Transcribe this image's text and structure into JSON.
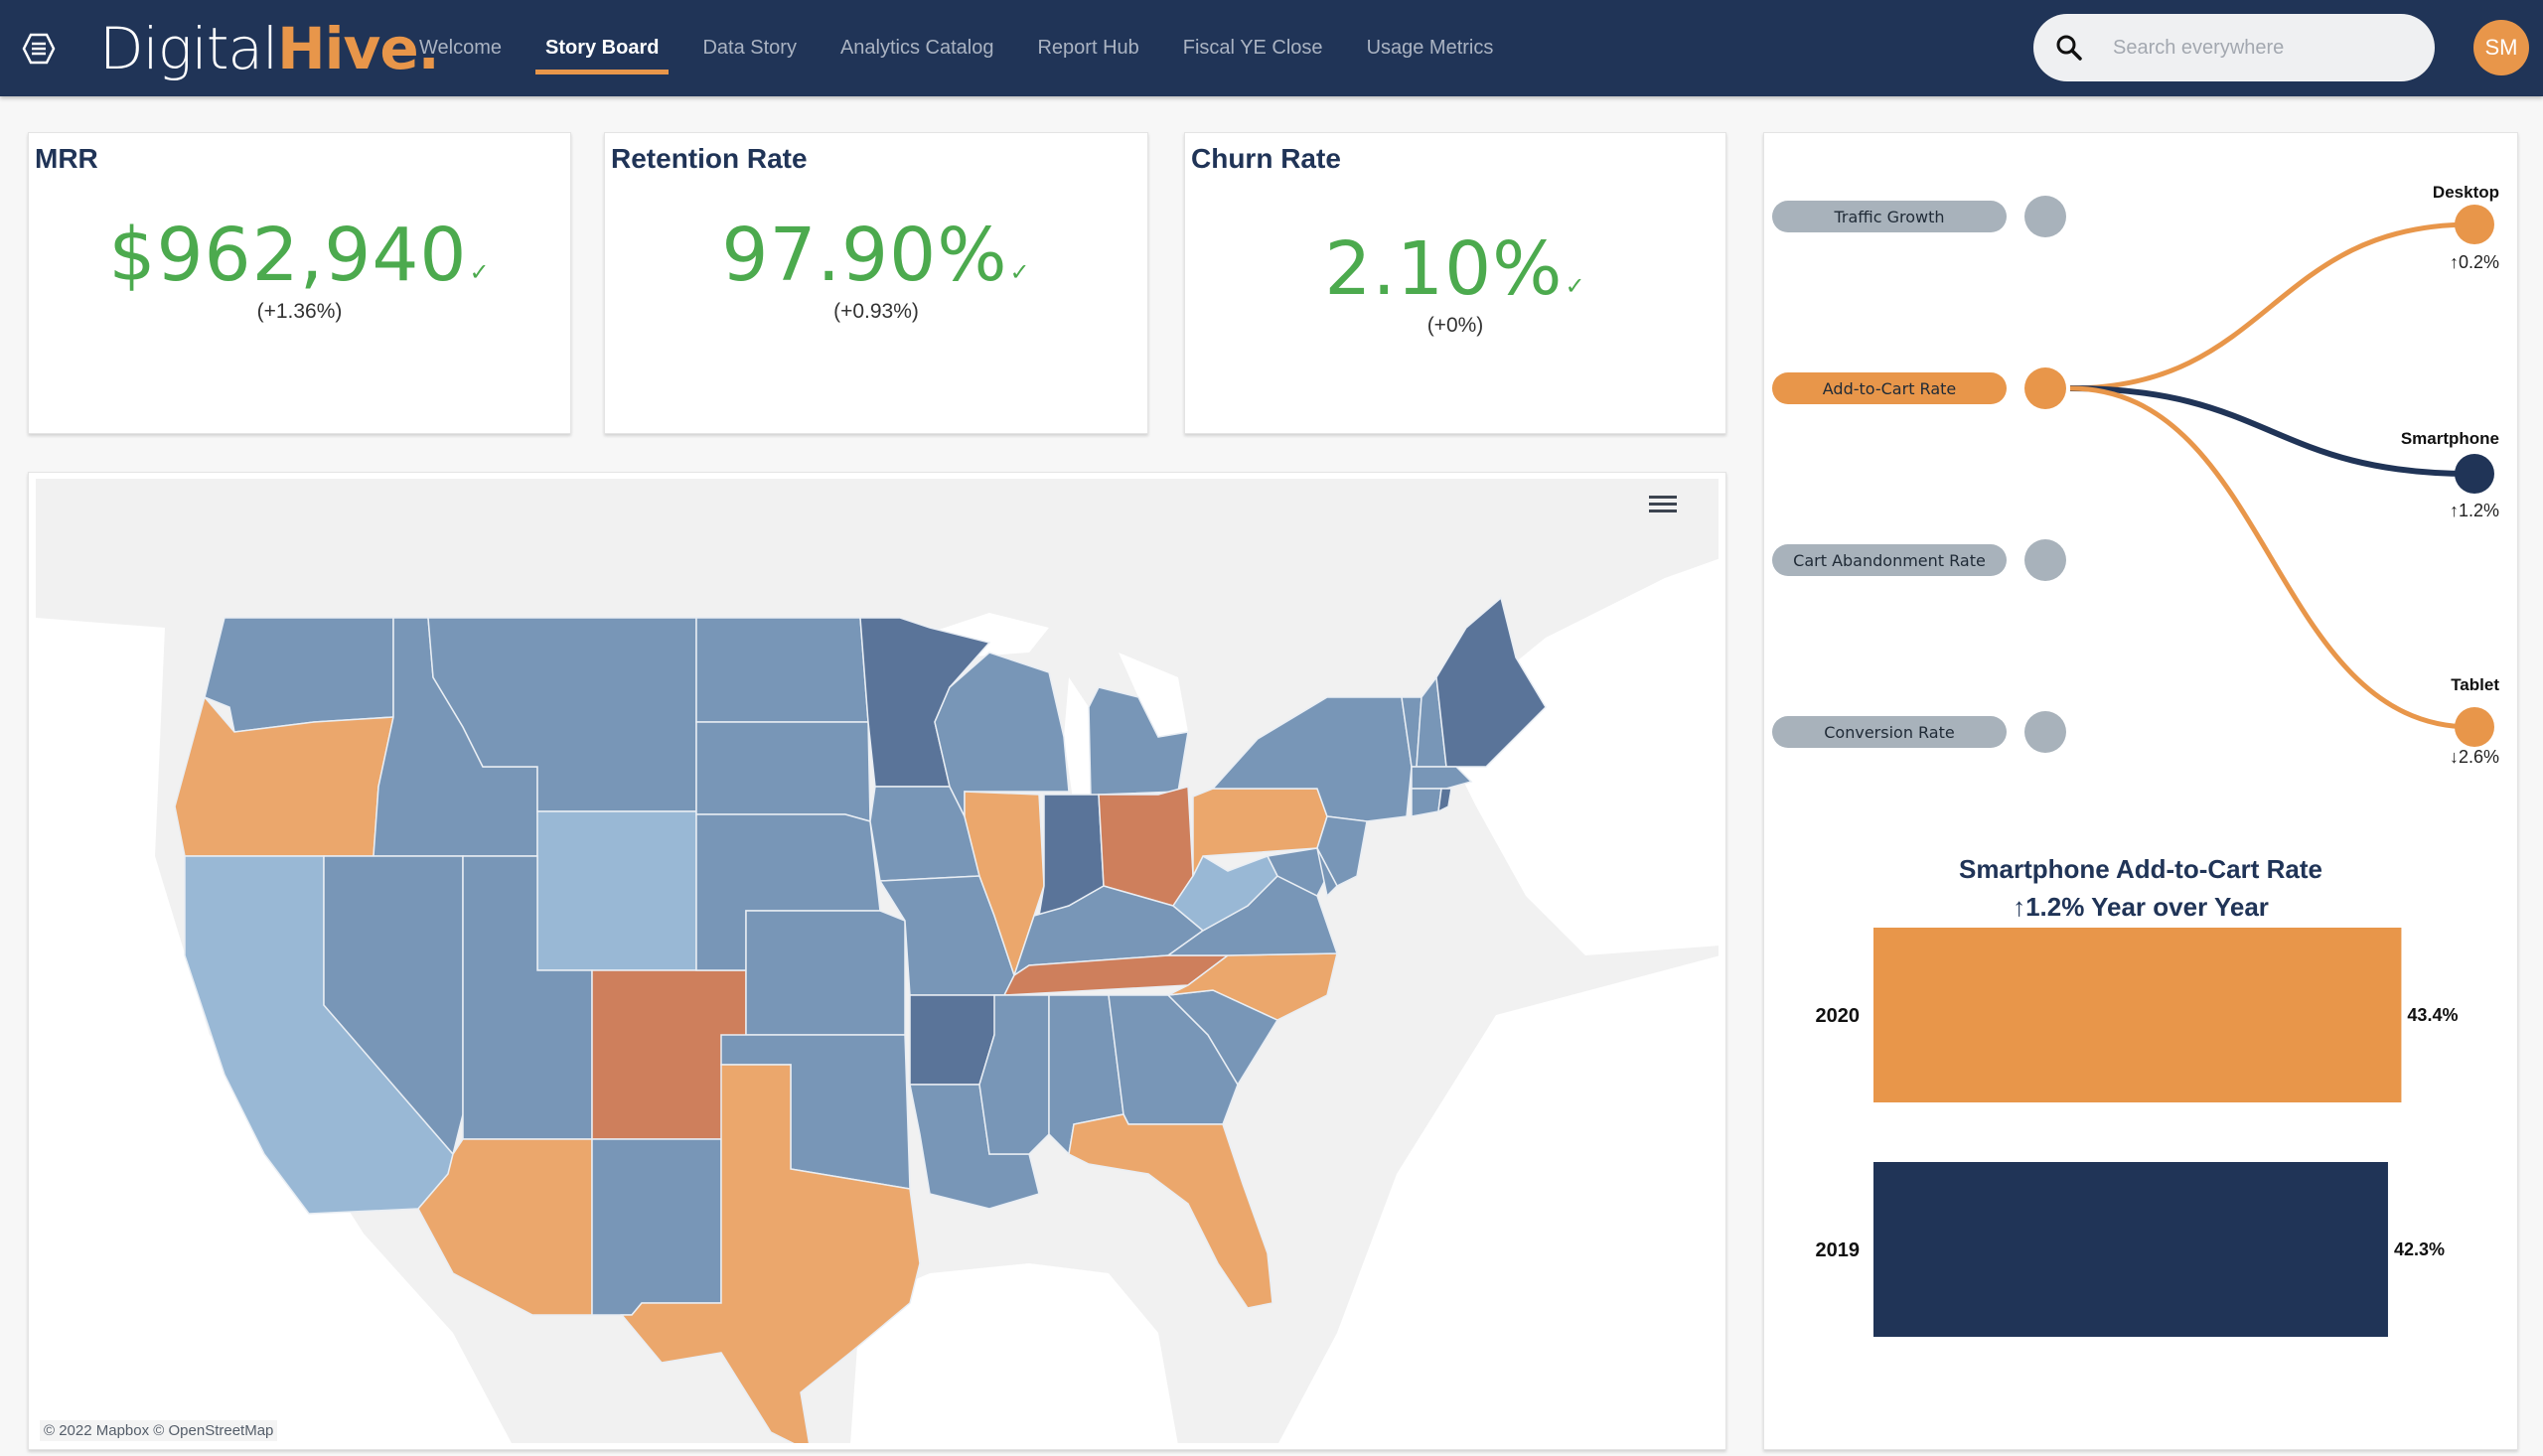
{
  "header": {
    "logo_part1": "Digital",
    "logo_part2": "Hive.",
    "nav": [
      {
        "label": "Welcome",
        "active": false
      },
      {
        "label": "Story Board",
        "active": true
      },
      {
        "label": "Data Story",
        "active": false
      },
      {
        "label": "Analytics Catalog",
        "active": false
      },
      {
        "label": "Report Hub",
        "active": false
      },
      {
        "label": "Fiscal YE Close",
        "active": false
      },
      {
        "label": "Usage Metrics",
        "active": false
      }
    ],
    "search_placeholder": "Search everywhere",
    "search_value": "",
    "avatar_initials": "SM",
    "colors": {
      "bg": "#203457",
      "accent": "#E8964A"
    }
  },
  "kpis": [
    {
      "title": "MRR",
      "value": "$962,940",
      "change": "(+1.36%)",
      "status": "check"
    },
    {
      "title": "Retention Rate",
      "value": "97.90%",
      "change": "(+0.93%)",
      "status": "check"
    },
    {
      "title": "Churn Rate",
      "value": "2.10%",
      "change": "(+0%)",
      "status": "check"
    }
  ],
  "map": {
    "attribution": "© 2022 Mapbox  © OpenStreetMap",
    "palette": {
      "light_blue": "#99B8D5",
      "mid_blue": "#7896B7",
      "dark_blue": "#5A7499",
      "orange": "#EBA76C",
      "dark_orange": "#CE7F5C",
      "land": "#f1f1f1",
      "water": "#ffffff"
    },
    "states": {
      "WA": "mid_blue",
      "OR": "orange",
      "CA": "light_blue",
      "ID": "mid_blue",
      "NV": "mid_blue",
      "MT": "mid_blue",
      "WY": "light_blue",
      "UT": "mid_blue",
      "AZ": "orange",
      "CO": "dark_orange",
      "NM": "mid_blue",
      "ND": "mid_blue",
      "SD": "mid_blue",
      "NE": "mid_blue",
      "KS": "mid_blue",
      "OK": "mid_blue",
      "TX": "orange",
      "MN": "dark_blue",
      "IA": "mid_blue",
      "MO": "mid_blue",
      "AR": "dark_blue",
      "LA": "mid_blue",
      "WI": "mid_blue",
      "IL": "orange",
      "MI": "mid_blue",
      "IN": "dark_blue",
      "OH": "dark_orange",
      "KY": "mid_blue",
      "TN": "dark_orange",
      "MS": "mid_blue",
      "AL": "mid_blue",
      "GA": "mid_blue",
      "FL": "orange",
      "SC": "mid_blue",
      "NC": "orange",
      "VA": "mid_blue",
      "WV": "light_blue",
      "PA": "orange",
      "NY": "mid_blue",
      "NJ": "mid_blue",
      "MD": "mid_blue",
      "DE": "mid_blue",
      "VT": "mid_blue",
      "NH": "mid_blue",
      "ME": "dark_blue",
      "MA": "mid_blue",
      "CT": "mid_blue",
      "RI": "dark_blue"
    }
  },
  "flow": {
    "metrics": [
      {
        "label": "Traffic Growth",
        "active": false
      },
      {
        "label": "Add-to-Cart Rate",
        "active": true
      },
      {
        "label": "Cart Abandonment Rate",
        "active": false
      },
      {
        "label": "Conversion Rate",
        "active": false
      }
    ],
    "devices": [
      {
        "label": "Desktop",
        "change": "↑0.2%",
        "color": "#E8964A"
      },
      {
        "label": "Smartphone",
        "change": "↑1.2%",
        "color": "#203457"
      },
      {
        "label": "Tablet",
        "change": "↓2.6%",
        "color": "#E8964A"
      }
    ],
    "inactive_color": "#a8b2bb"
  },
  "chart_data": {
    "type": "bar",
    "orientation": "horizontal",
    "title": "Smartphone Add-to-Cart Rate",
    "subtitle": "↑1.2% Year over Year",
    "categories": [
      "2020",
      "2019"
    ],
    "values": [
      43.4,
      42.3
    ],
    "value_labels": [
      "43.4%",
      "42.3%"
    ],
    "colors": [
      "#E8964A",
      "#203457"
    ],
    "xlabel": "",
    "ylabel": "",
    "xlim": [
      0,
      49
    ],
    "grid": false,
    "legend": "none"
  }
}
